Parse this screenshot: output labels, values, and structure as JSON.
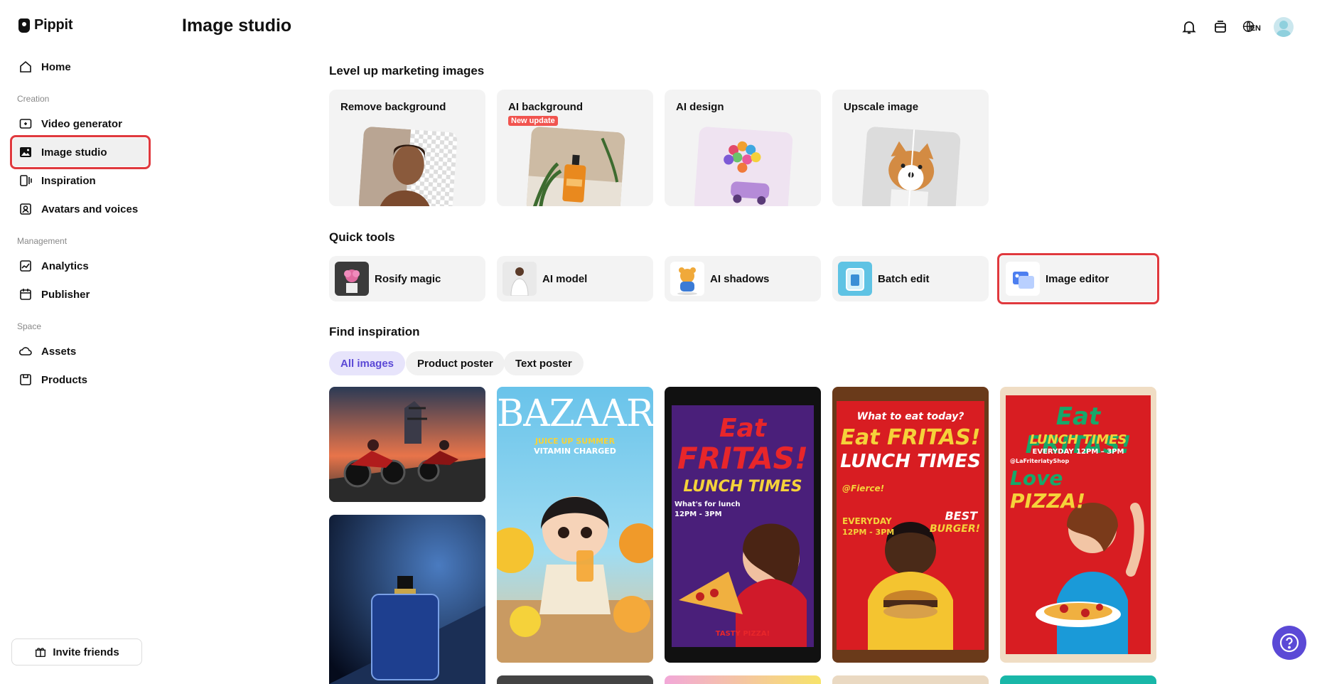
{
  "app": {
    "name": "Pippit"
  },
  "header": {
    "title": "Image studio",
    "lang_code": "EN"
  },
  "sidebar": {
    "home": "Home",
    "sections": {
      "creation": "Creation",
      "management": "Management",
      "space": "Space"
    },
    "items": {
      "video_generator": "Video generator",
      "image_studio": "Image studio",
      "inspiration": "Inspiration",
      "avatars": "Avatars and voices",
      "analytics": "Analytics",
      "publisher": "Publisher",
      "assets": "Assets",
      "products": "Products"
    },
    "invite": "Invite friends"
  },
  "level_up": {
    "title": "Level up marketing images",
    "cards": {
      "remove_bg": "Remove background",
      "ai_bg": "AI background",
      "ai_bg_badge": "New update",
      "ai_design": "AI design",
      "upscale": "Upscale image"
    }
  },
  "quick_tools": {
    "title": "Quick tools",
    "items": {
      "rosify": "Rosify magic",
      "ai_model": "AI model",
      "ai_shadows": "AI shadows",
      "batch_edit": "Batch edit",
      "image_editor": "Image editor"
    }
  },
  "inspiration": {
    "title": "Find inspiration",
    "filters": {
      "all": "All images",
      "product": "Product poster",
      "text": "Text poster"
    },
    "posters": {
      "bazaar": "BAZAAR",
      "bazaar_sub1": "JUICE UP SUMMER",
      "bazaar_sub2": "VITAMIN CHARGED",
      "eat": "Eat",
      "fritas": "FRITAS!",
      "lunch": "LUNCH TIMES",
      "whats": "What's for lunch",
      "hours": "12PM - 3PM",
      "tasty": "TASTY PIZZA!",
      "what_to_eat": "What to eat today?",
      "eat_fritas": "Eat FRITAS!",
      "fierce": "@Fierce!",
      "everyday": "EVERYDAY",
      "best": "BEST",
      "burger": "BURGER!",
      "everyday_hours": "EVERYDAY 12PM – 3PM",
      "shop": "@LaFriteriatyShop",
      "love": "Love",
      "pizza": "PIZZA!"
    }
  },
  "colors": {
    "accent": "#5b49d6",
    "highlight": "#e0393e",
    "badge": "#f1544f"
  }
}
